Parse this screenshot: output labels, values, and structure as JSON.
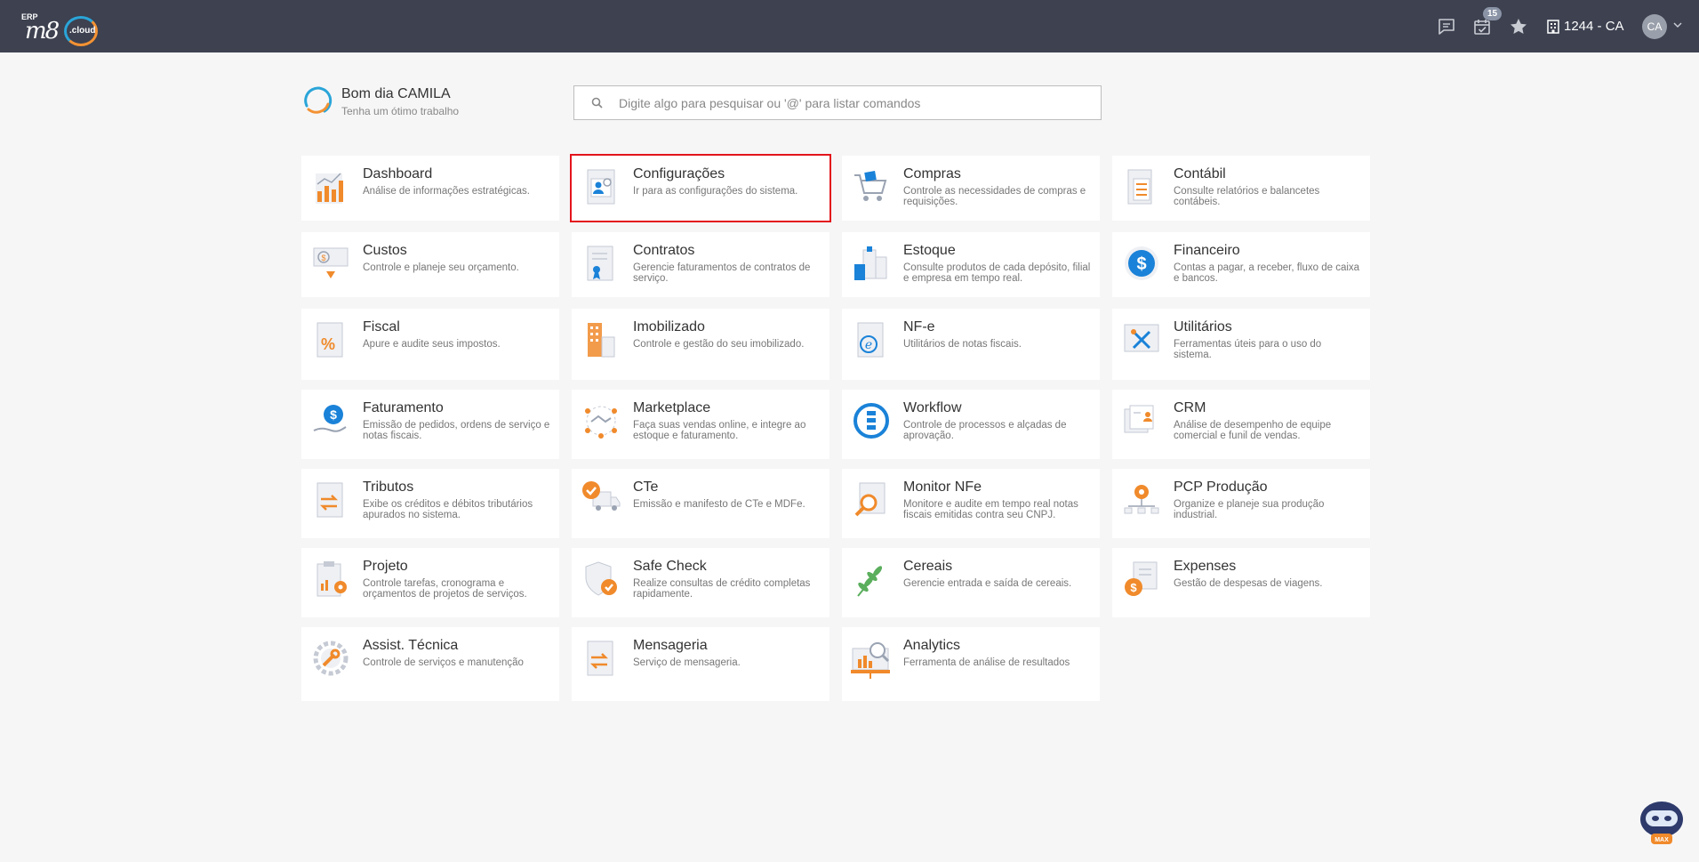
{
  "header": {
    "logo_erp": "ERP",
    "logo_m8": "m8",
    "logo_cloud": ".cloud",
    "calendar_badge": "15",
    "company": "1244 - CA",
    "avatar_initials": "CA"
  },
  "greeting": {
    "title": "Bom dia CAMILA",
    "subtitle": "Tenha um ótimo trabalho"
  },
  "search": {
    "placeholder": "Digite algo para pesquisar ou '@' para listar comandos"
  },
  "colors": {
    "topbar": "#3d4150",
    "accent_blue": "#1a82d8",
    "accent_orange": "#f08a2b",
    "selected_outline": "#e3141b"
  },
  "modules": [
    {
      "title": "Dashboard",
      "desc": "Análise de informações estratégicas.",
      "icon": "bar-chart-icon"
    },
    {
      "title": "Configurações",
      "desc": "Ir para as configurações do sistema.",
      "icon": "settings-user-icon"
    },
    {
      "title": "Compras",
      "desc": "Controle as necessidades de compras e requisições.",
      "icon": "shopping-cart-icon"
    },
    {
      "title": "Contábil",
      "desc": "Consulte relatórios e balancetes contábeis.",
      "icon": "calculator-icon"
    },
    {
      "title": "Custos",
      "desc": "Controle e planeje seu orçamento.",
      "icon": "money-down-icon"
    },
    {
      "title": "Contratos",
      "desc": "Gerencie faturamentos de contratos de serviço.",
      "icon": "contract-icon"
    },
    {
      "title": "Estoque",
      "desc": "Consulte produtos de cada depósito, filial e empresa em tempo real.",
      "icon": "warehouse-icon"
    },
    {
      "title": "Financeiro",
      "desc": "Contas a pagar, a receber, fluxo de caixa e bancos.",
      "icon": "dollar-circle-icon"
    },
    {
      "title": "Fiscal",
      "desc": "Apure e audite seus impostos.",
      "icon": "percent-document-icon"
    },
    {
      "title": "Imobilizado",
      "desc": "Controle e gestão do seu imobilizado.",
      "icon": "building-icon"
    },
    {
      "title": "NF-e",
      "desc": "Utilitários de notas fiscais.",
      "icon": "nfe-document-icon"
    },
    {
      "title": "Utilitários",
      "desc": "Ferramentas úteis para o uso do sistema.",
      "icon": "tools-icon"
    },
    {
      "title": "Faturamento",
      "desc": "Emissão de pedidos, ordens de serviço e notas fiscais.",
      "icon": "dollar-hand-icon"
    },
    {
      "title": "Marketplace",
      "desc": "Faça suas vendas online, e integre ao estoque e faturamento.",
      "icon": "handshake-icon"
    },
    {
      "title": "Workflow",
      "desc": "Controle de processos e alçadas de aprovação.",
      "icon": "workflow-icon"
    },
    {
      "title": "CRM",
      "desc": "Análise de desempenho de equipe comercial e funil de vendas.",
      "icon": "crm-cards-icon"
    },
    {
      "title": "Tributos",
      "desc": "Exibe os créditos e débitos tributários apurados no sistema.",
      "icon": "exchange-document-icon"
    },
    {
      "title": "CTe",
      "desc": "Emissão e manifesto de CTe e MDFe.",
      "icon": "truck-check-icon"
    },
    {
      "title": "Monitor NFe",
      "desc": "Monitore e audite em tempo real notas fiscais emitidas contra seu CNPJ.",
      "icon": "magnifier-document-icon"
    },
    {
      "title": "PCP Produção",
      "desc": "Organize e planeje sua produção industrial.",
      "icon": "gear-network-icon"
    },
    {
      "title": "Projeto",
      "desc": "Controle tarefas, cronograma e orçamentos de projetos de serviços.",
      "icon": "clipboard-gear-icon"
    },
    {
      "title": "Safe Check",
      "desc": "Realize consultas de crédito completas rapidamente.",
      "icon": "shield-check-icon"
    },
    {
      "title": "Cereais",
      "desc": "Gerencie entrada e saída de cereais.",
      "icon": "wheat-icon"
    },
    {
      "title": "Expenses",
      "desc": "Gestão de despesas de viagens.",
      "icon": "expenses-icon"
    },
    {
      "title": "Assist. Técnica",
      "desc": "Controle de serviços e manutenção",
      "icon": "wrench-gear-icon"
    },
    {
      "title": "Mensageria",
      "desc": "Serviço de mensageria.",
      "icon": "message-exchange-icon"
    },
    {
      "title": "Analytics",
      "desc": "Ferramenta de análise de resultados",
      "icon": "analytics-board-icon"
    }
  ],
  "selected_module": "Configurações"
}
